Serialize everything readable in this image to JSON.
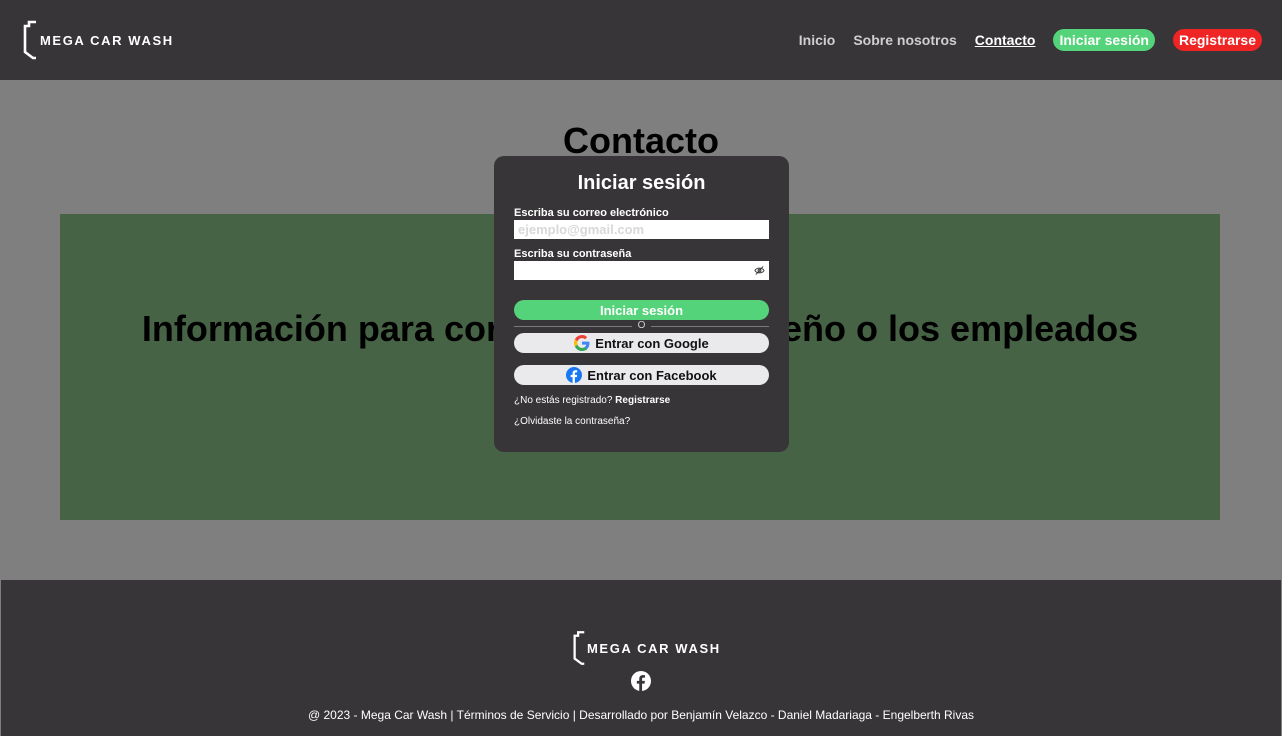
{
  "brand": {
    "name": "MEGA CAR WASH"
  },
  "nav": {
    "items": [
      {
        "label": "Inicio"
      },
      {
        "label": "Sobre nosotros"
      },
      {
        "label": "Contacto"
      }
    ],
    "login_label": "Iniciar sesión",
    "register_label": "Registrarse"
  },
  "main": {
    "title": "Contacto",
    "info_text": "Información para contactar con el diseño o los empleados"
  },
  "modal": {
    "title": "Iniciar sesión",
    "email_label": "Escriba su correo electrónico",
    "email_placeholder": "ejemplo@gmail.com",
    "password_label": "Escriba su contraseña",
    "submit_label": "Iniciar sesión",
    "divider_text": "O",
    "google_label": "Entrar con Google",
    "facebook_label": "Entrar con Facebook",
    "not_registered_text": "¿No estás registrado?",
    "register_link": "Registrarse",
    "forgot_password": "¿Olvidaste la contraseña?"
  },
  "footer": {
    "brand": "MEGA CAR WASH",
    "copyright": "@ 2023 - Mega Car Wash | Términos de Servicio | Desarrollado por Benjamín Velazco - Daniel Madariaga - Engelberth Rivas"
  },
  "colors": {
    "header_bg": "#373537",
    "green": "#55d37a",
    "red": "#ef2424",
    "overlay": "#7f7f7f",
    "panel": "#476346"
  },
  "icons": [
    "car-wash-logo-icon",
    "eye-off-icon",
    "google-icon",
    "facebook-icon"
  ]
}
